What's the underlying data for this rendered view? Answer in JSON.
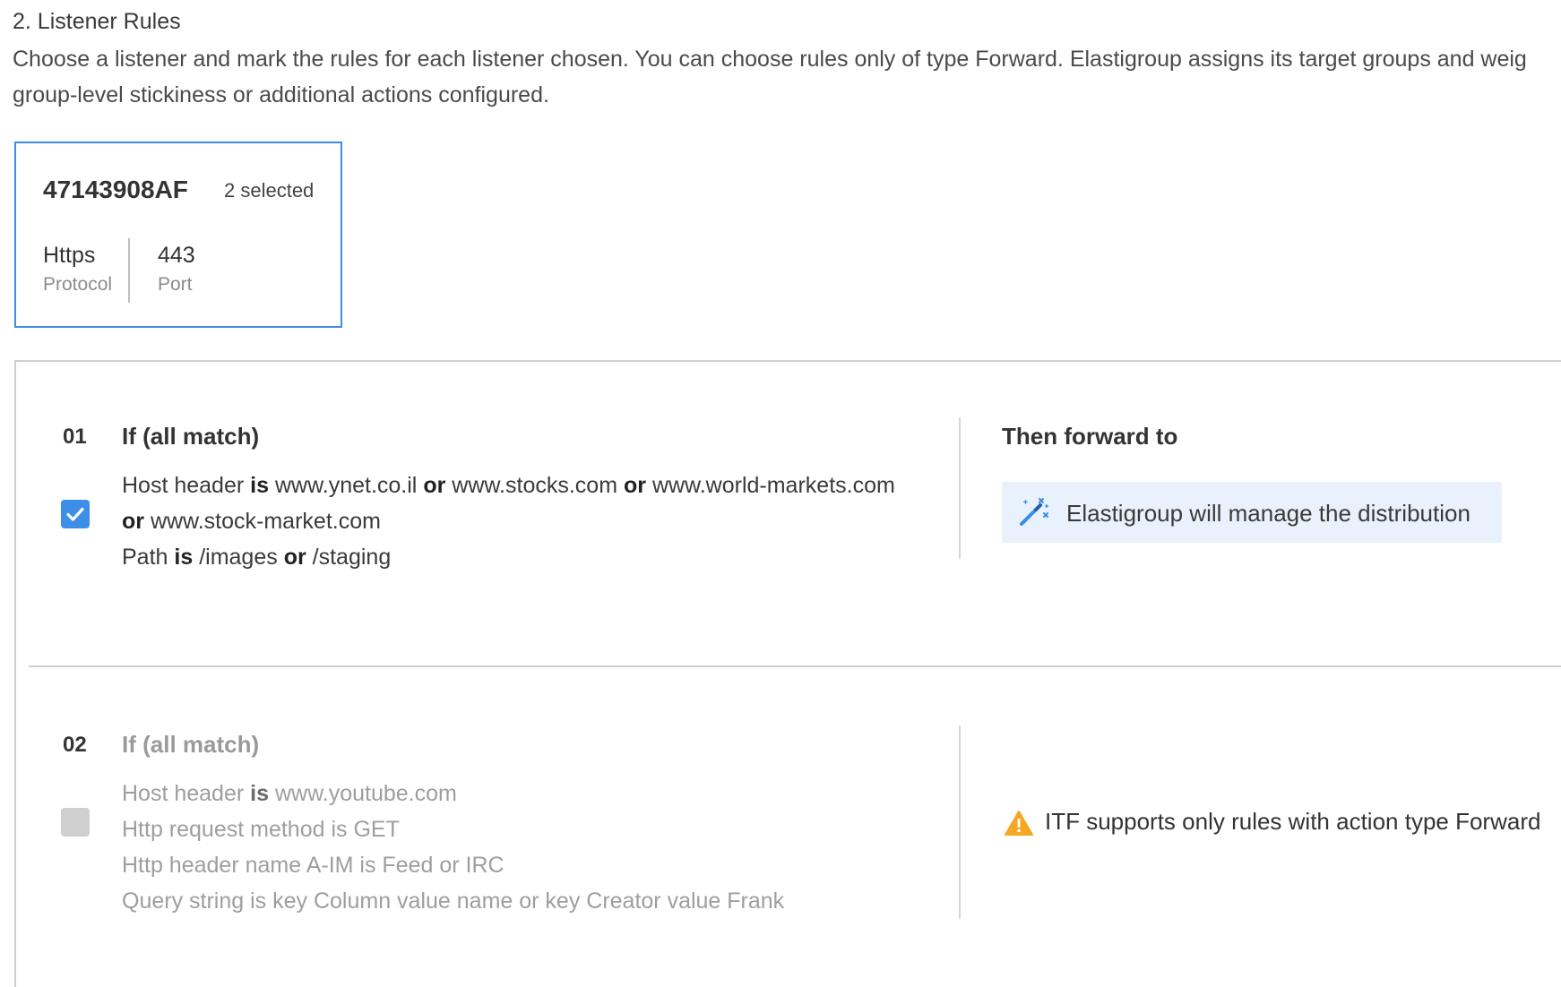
{
  "section": {
    "title": "2. Listener Rules",
    "description_line1": "Choose a listener and mark the rules for each listener chosen. You can choose rules only of type Forward. Elastigroup assigns its target groups and weig",
    "description_line2": "group-level stickiness or additional actions configured."
  },
  "listener": {
    "id": "47143908AF",
    "selected": "2 selected",
    "protocol_value": "Https",
    "protocol_label": "Protocol",
    "port_value": "443",
    "port_label": "Port"
  },
  "rules": [
    {
      "number": "01",
      "heading": "If (all match)",
      "checked": true,
      "line1": {
        "a": "Host header",
        "b": "is",
        "c": "www.ynet.co.il",
        "d": "or",
        "e": "www.stocks.com",
        "f": "or",
        "g": "www.world-markets.com"
      },
      "line2": {
        "a": "or",
        "b": "www.stock-market.com"
      },
      "line3": {
        "a": "Path",
        "b": "is",
        "c": "/images",
        "d": "or",
        "e": "/staging"
      },
      "then_heading": "Then forward to",
      "then_text": "Elastigroup will manage the distribution"
    },
    {
      "number": "02",
      "heading": "If (all match)",
      "checked": false,
      "line1": {
        "a": "Host header",
        "b": "is",
        "c": "www.youtube.com"
      },
      "line2": "Http request method is GET",
      "line3": "Http header name A-IM is Feed or IRC",
      "line4": "Query string is key Column value name or key Creator value Frank",
      "warning": "ITF supports only rules with action type Forward"
    }
  ],
  "colors": {
    "accent": "#3d8ee6",
    "info_bg": "#e9f1fc",
    "warning": "#f5a623"
  },
  "icons": {
    "checkbox_checked": "check-icon",
    "distribution": "magic-wand-icon",
    "warning": "warning-triangle-icon"
  }
}
